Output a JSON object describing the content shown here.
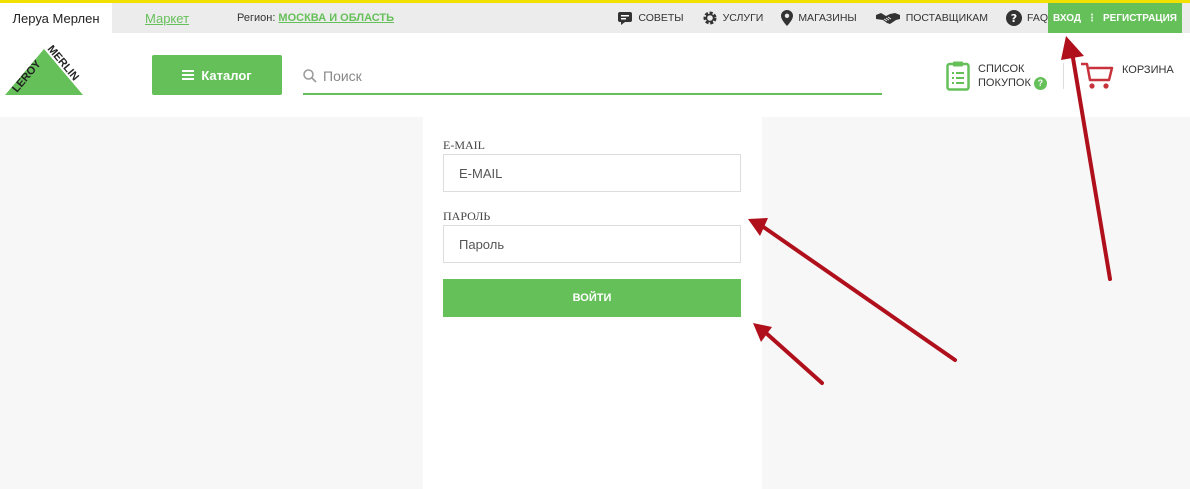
{
  "topbar": {
    "active_tab": "Леруа Мерлен",
    "market_link": "Маркет",
    "region_label": "Регион:",
    "region_value": "МОСКВА И ОБЛАСТЬ",
    "links": {
      "tips": "СОВЕТЫ",
      "services": "УСЛУГИ",
      "stores": "МАГАЗИНЫ",
      "suppliers": "ПОСТАВЩИКАМ",
      "faq": "FAQ"
    },
    "login": "ВХОД",
    "register": "РЕГИСТРАЦИЯ"
  },
  "header": {
    "logo_top": "LEROY",
    "logo_bottom": "MERLIN",
    "catalog_label": "Каталог",
    "search_placeholder": "Поиск",
    "shopping_list_line1": "СПИСОК",
    "shopping_list_line2": "ПОКУПОК",
    "help_badge": "?",
    "cart_label": "КОРЗИНА"
  },
  "login_form": {
    "email_label": "E-MAIL",
    "email_placeholder": "E-MAIL",
    "password_label": "ПАРОЛЬ",
    "password_placeholder": "Пароль",
    "submit_label": "ВОЙТИ"
  },
  "colors": {
    "brand_green": "#66c05a",
    "accent_yellow": "#f2e000",
    "annotation_red": "#b0101c"
  }
}
